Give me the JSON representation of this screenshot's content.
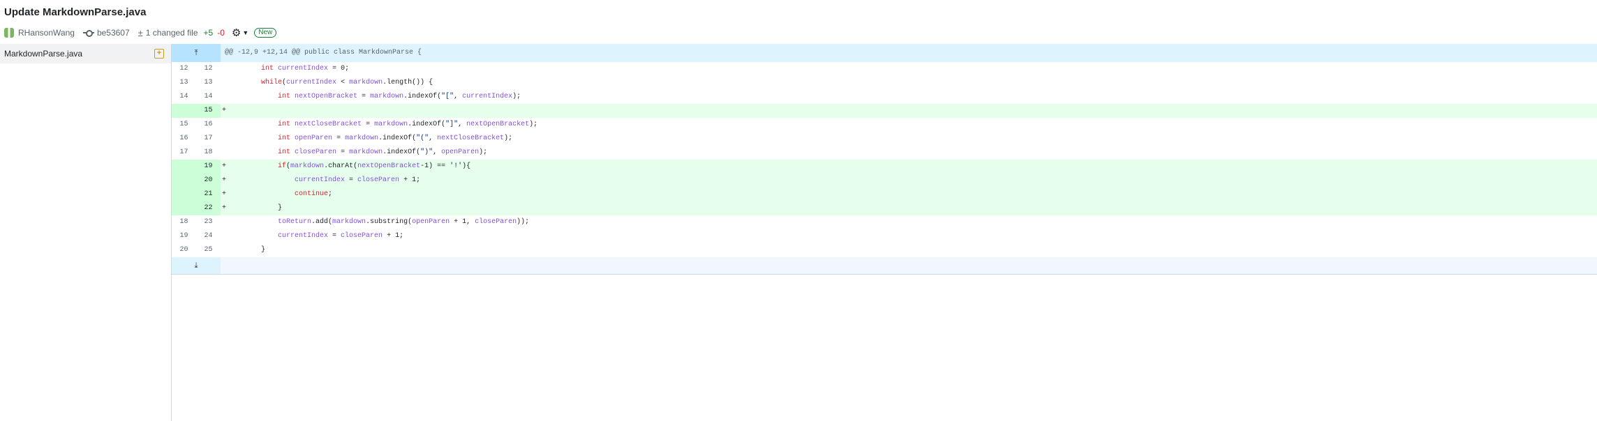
{
  "header": {
    "title": "Update MarkdownParse.java",
    "author": "RHansonWang",
    "commit_sha": "be53607",
    "changed_files": "1 changed file",
    "additions": "+5",
    "deletions": "-0",
    "badge": "New"
  },
  "sidebar": {
    "files": [
      {
        "name": "MarkdownParse.java",
        "status_icon": "file-added-icon"
      }
    ]
  },
  "diff": {
    "hunk_header": "@@ -12,9 +12,14 @@ public class MarkdownParse {",
    "expand_up_icon": "expand-up-icon",
    "expand_down_icon": "expand-down-icon",
    "colors": {
      "add_bg": "#e6ffec",
      "add_gutter": "#ccffd8",
      "hunk_bg": "#ddf4ff"
    },
    "lines": [
      {
        "old": "12",
        "new": "12",
        "type": "ctx",
        "marker": "",
        "code": "        int currentIndex = 0;"
      },
      {
        "old": "13",
        "new": "13",
        "type": "ctx",
        "marker": "",
        "code": "        while(currentIndex < markdown.length()) {"
      },
      {
        "old": "14",
        "new": "14",
        "type": "ctx",
        "marker": "",
        "code": "            int nextOpenBracket = markdown.indexOf(\"[\", currentIndex);"
      },
      {
        "old": "",
        "new": "15",
        "type": "add",
        "marker": "+",
        "code": ""
      },
      {
        "old": "15",
        "new": "16",
        "type": "ctx",
        "marker": "",
        "code": "            int nextCloseBracket = markdown.indexOf(\"]\", nextOpenBracket);"
      },
      {
        "old": "16",
        "new": "17",
        "type": "ctx",
        "marker": "",
        "code": "            int openParen = markdown.indexOf(\"(\", nextCloseBracket);"
      },
      {
        "old": "17",
        "new": "18",
        "type": "ctx",
        "marker": "",
        "code": "            int closeParen = markdown.indexOf(\")\", openParen);"
      },
      {
        "old": "",
        "new": "19",
        "type": "add",
        "marker": "+",
        "code": "            if(markdown.charAt(nextOpenBracket-1) == '!'){"
      },
      {
        "old": "",
        "new": "20",
        "type": "add",
        "marker": "+",
        "code": "                currentIndex = closeParen + 1;"
      },
      {
        "old": "",
        "new": "21",
        "type": "add",
        "marker": "+",
        "code": "                continue;"
      },
      {
        "old": "",
        "new": "22",
        "type": "add",
        "marker": "+",
        "code": "            }"
      },
      {
        "old": "18",
        "new": "23",
        "type": "ctx",
        "marker": "",
        "code": "            toReturn.add(markdown.substring(openParen + 1, closeParen));"
      },
      {
        "old": "19",
        "new": "24",
        "type": "ctx",
        "marker": "",
        "code": "            currentIndex = closeParen + 1;"
      },
      {
        "old": "20",
        "new": "25",
        "type": "ctx",
        "marker": "",
        "code": "        }"
      }
    ]
  }
}
